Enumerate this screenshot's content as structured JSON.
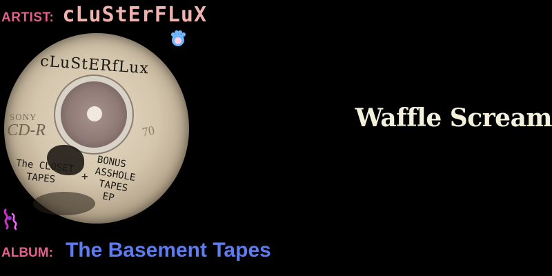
{
  "artist": {
    "label": "ARTIST:",
    "name": "cLuStErFLuX"
  },
  "album": {
    "label": "ALBUM:",
    "name": "The Basement Tapes"
  },
  "track": {
    "title": "Waffle Scream"
  },
  "cover_art": {
    "handwritten_title": "cLuStERfLux",
    "brand": "SONY",
    "format": "CD-R",
    "minutes": "70",
    "handwritten_left": "The CLOSET\n  TAPES",
    "plus": "+",
    "handwritten_right": "BONUS\nASSHOLE\n TAPES\n  EP"
  },
  "icons": {
    "paw": "paw-icon",
    "pink_glyph": "pink-glyph-icon"
  },
  "colors": {
    "background": "#000000",
    "label_pink": "#e2608a",
    "artist_name": "#f0b4b0",
    "album_blue": "#5d7cf0",
    "track_title": "#f3f0dc"
  }
}
